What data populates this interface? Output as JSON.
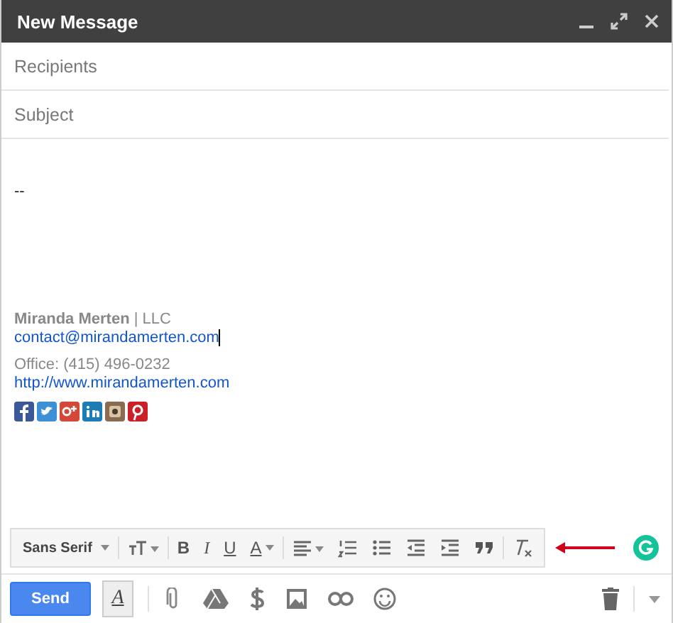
{
  "window": {
    "title": "New Message"
  },
  "recipients": {
    "placeholder": "Recipients"
  },
  "subject": {
    "placeholder": "Subject"
  },
  "body": {
    "separator": "--",
    "signature": {
      "name_line": "**Miranda Merten** | LLC",
      "email": "contact@mirandamerten.com",
      "office": "Office: (415) 496-0232",
      "website": "http://www.mirandamerten.com"
    },
    "social": [
      {
        "kind": "facebook",
        "color": "#3b5998"
      },
      {
        "kind": "twitter",
        "color": "#3d8fd6"
      },
      {
        "kind": "googleplus",
        "color": "#d34836"
      },
      {
        "kind": "linkedin",
        "color": "#1c7cb6"
      },
      {
        "kind": "instagram",
        "color": "#8a6a50"
      },
      {
        "kind": "pinterest",
        "color": "#cb2027"
      }
    ]
  },
  "format_toolbar": {
    "font": "Sans Serif",
    "items": [
      {
        "kind": "size"
      },
      {
        "kind": "bold",
        "label": "B"
      },
      {
        "kind": "italic",
        "label": "I"
      },
      {
        "kind": "underline",
        "label": "U"
      },
      {
        "kind": "color",
        "label": "A"
      },
      {
        "kind": "align"
      },
      {
        "kind": "numbered"
      },
      {
        "kind": "bulleted"
      },
      {
        "kind": "outdent"
      },
      {
        "kind": "indent"
      },
      {
        "kind": "quote"
      },
      {
        "kind": "clear"
      }
    ]
  },
  "bottom_bar": {
    "send": "Send",
    "format_toggle": {
      "label": "A",
      "selected": true
    }
  }
}
